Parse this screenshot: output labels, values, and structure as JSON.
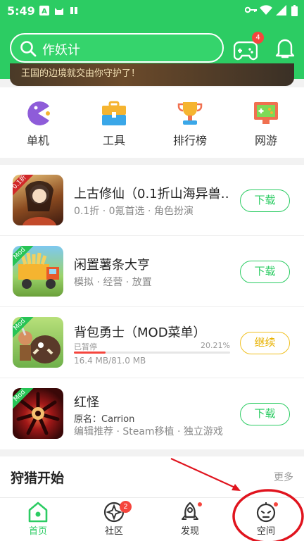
{
  "status": {
    "time": "5:49"
  },
  "search": {
    "placeholder": "作妖计"
  },
  "header": {
    "game_badge": "4"
  },
  "banner": {
    "text": "王国的边境就交由你守护了！"
  },
  "categories": [
    {
      "label": "单机",
      "icon": "pacman-icon"
    },
    {
      "label": "工具",
      "icon": "toolbox-icon"
    },
    {
      "label": "排行榜",
      "icon": "trophy-icon"
    },
    {
      "label": "网游",
      "icon": "gamepad-icon"
    }
  ],
  "games": [
    {
      "name": "上古修仙（0.1折山海异兽…",
      "meta": "0.1折 · 0氪首选 · 角色扮演",
      "button": "下载",
      "tag": "0.1折"
    },
    {
      "name": "闲置薯条大亨",
      "meta": "模拟 · 经营 · 放置",
      "button": "下载",
      "tag": "Mod"
    },
    {
      "name": "背包勇士（MOD菜单）",
      "status": "已暂停",
      "progress_pct": "20.21%",
      "progress": 0.2021,
      "size": "16.4 MB/81.0 MB",
      "button": "继续",
      "tag": "Mod"
    },
    {
      "name": "红怪",
      "original": "原名：Carrion",
      "meta": "编辑推荐 · Steam移植 · 独立游戏",
      "button": "下载",
      "tag": "Mod"
    }
  ],
  "section": {
    "title": "狩猎开始",
    "more": "更多"
  },
  "tabs": [
    {
      "label": "首页",
      "active": true
    },
    {
      "label": "社区",
      "badge": "2"
    },
    {
      "label": "发现"
    },
    {
      "label": "空间"
    }
  ],
  "colors": {
    "brand": "#2ccc63",
    "badge": "#f5453d",
    "continue": "#f0c020",
    "annotation": "#e0141e"
  }
}
